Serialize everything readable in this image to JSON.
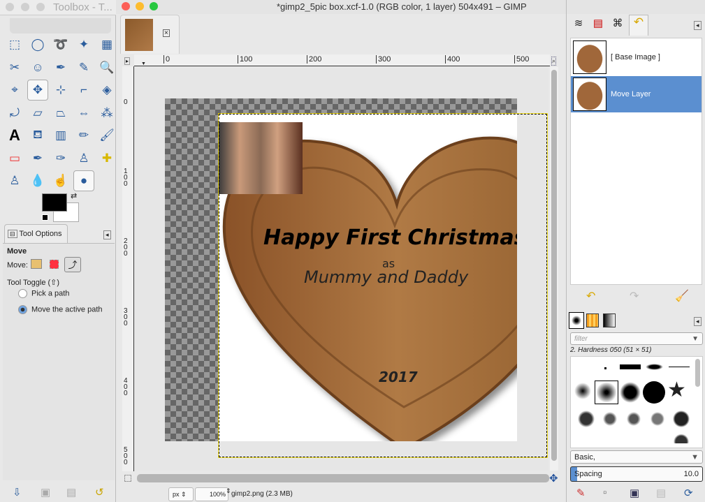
{
  "toolbox": {
    "title": "Toolbox - T...",
    "tool_options_tab": "Tool Options",
    "tool_name": "Move",
    "move_label": "Move:",
    "tool_toggle": "Tool Toggle  (⇧)",
    "options": [
      "Pick a path",
      "Move the active path"
    ],
    "selected_option": 1,
    "tools": [
      "rect-select",
      "ellipse-select",
      "free-select",
      "fuzzy-select",
      "select-by-color",
      "scissors",
      "foreground-select",
      "paths",
      "color-picker",
      "zoom",
      "measure",
      "move",
      "align",
      "crop",
      "unified-transform",
      "rotate",
      "shear",
      "perspective",
      "flip",
      "cage-transform",
      "text",
      "bucket-fill",
      "blend",
      "pencil",
      "paintbrush",
      "eraser",
      "airbrush",
      "ink",
      "clone",
      "heal",
      "perspective-clone",
      "blur",
      "smudge",
      "dodge-burn"
    ],
    "fg_color": "#000000",
    "bg_color": "#ffffff"
  },
  "image_window": {
    "title": "*gimp2_5pic box.xcf-1.0 (RGB color, 1 layer) 504x491 – GIMP",
    "ruler_h": [
      "0",
      "100",
      "200",
      "300",
      "400",
      "500"
    ],
    "ruler_v": [
      "0",
      "100",
      "200",
      "300",
      "400",
      "500"
    ],
    "canvas_text": {
      "line1": "Happy First Christmas",
      "line2": "as",
      "line3": "Mummy and Daddy",
      "year": "2017"
    },
    "status": {
      "unit": "px",
      "zoom": "100%",
      "file": "gimp2.png (2.3 MB)"
    }
  },
  "layers_panel": {
    "items": [
      {
        "name": "[ Base Image ]",
        "selected": false
      },
      {
        "name": "Move Layer",
        "selected": true
      }
    ]
  },
  "brushes_panel": {
    "filter_placeholder": "filter",
    "brush_name": "2. Hardness 050 (51 × 51)",
    "tag": "Basic,",
    "spacing_label": "Spacing",
    "spacing_value": "10.0"
  },
  "colors": {
    "selection": "#5b8fd0",
    "wood": "#a0673a"
  }
}
